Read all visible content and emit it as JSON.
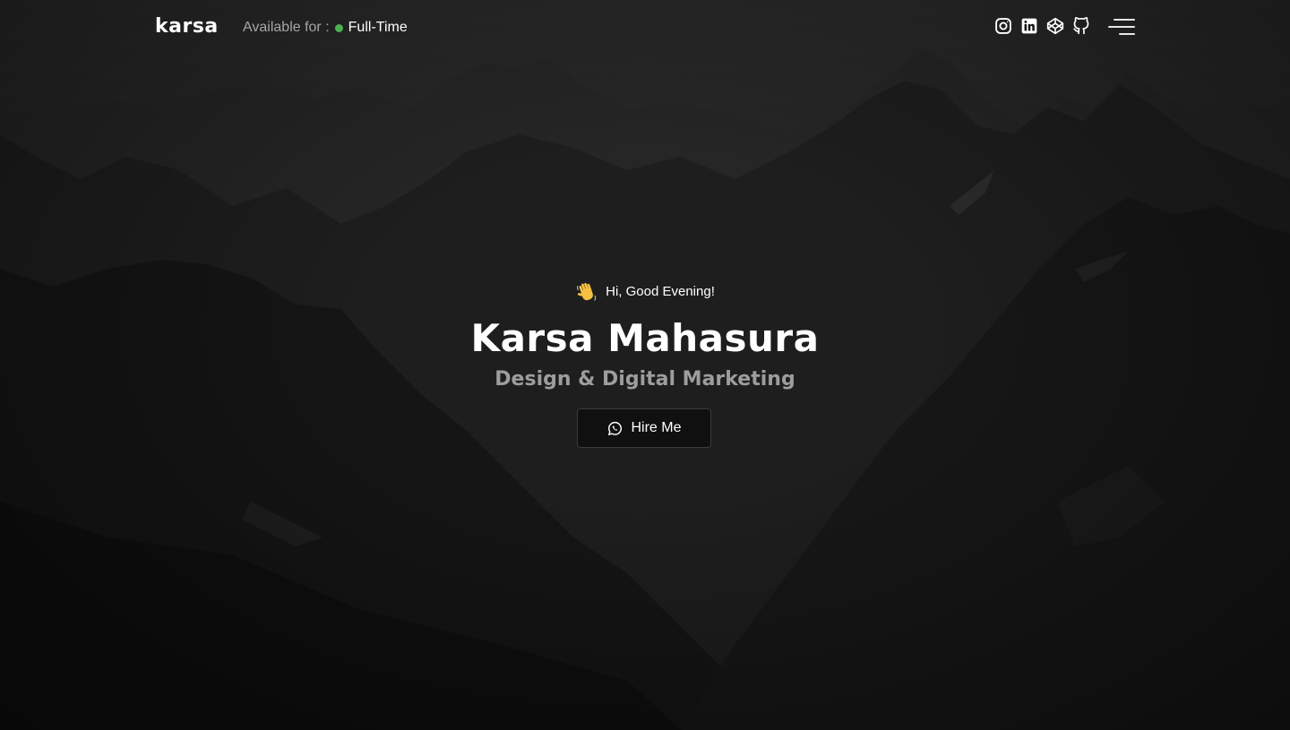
{
  "header": {
    "logo": "karsa",
    "availability_label": "Available for :",
    "availability_value": "Full-Time",
    "status_color": "#4caf50",
    "social_links": [
      {
        "icon": "instagram-icon"
      },
      {
        "icon": "linkedin-icon"
      },
      {
        "icon": "codepen-icon"
      },
      {
        "icon": "github-icon"
      }
    ],
    "menu_icon": "hamburger-menu-icon"
  },
  "hero": {
    "greeting_icon": "waving-hand-icon",
    "greeting": "Hi, Good Evening!",
    "name": "Karsa Mahasura",
    "role": "Design & Digital Marketing",
    "cta_icon": "whatsapp-icon",
    "cta_label": "Hire Me"
  },
  "colors": {
    "background": "#141414",
    "text": "#ffffff",
    "muted": "#9d9d9d"
  }
}
